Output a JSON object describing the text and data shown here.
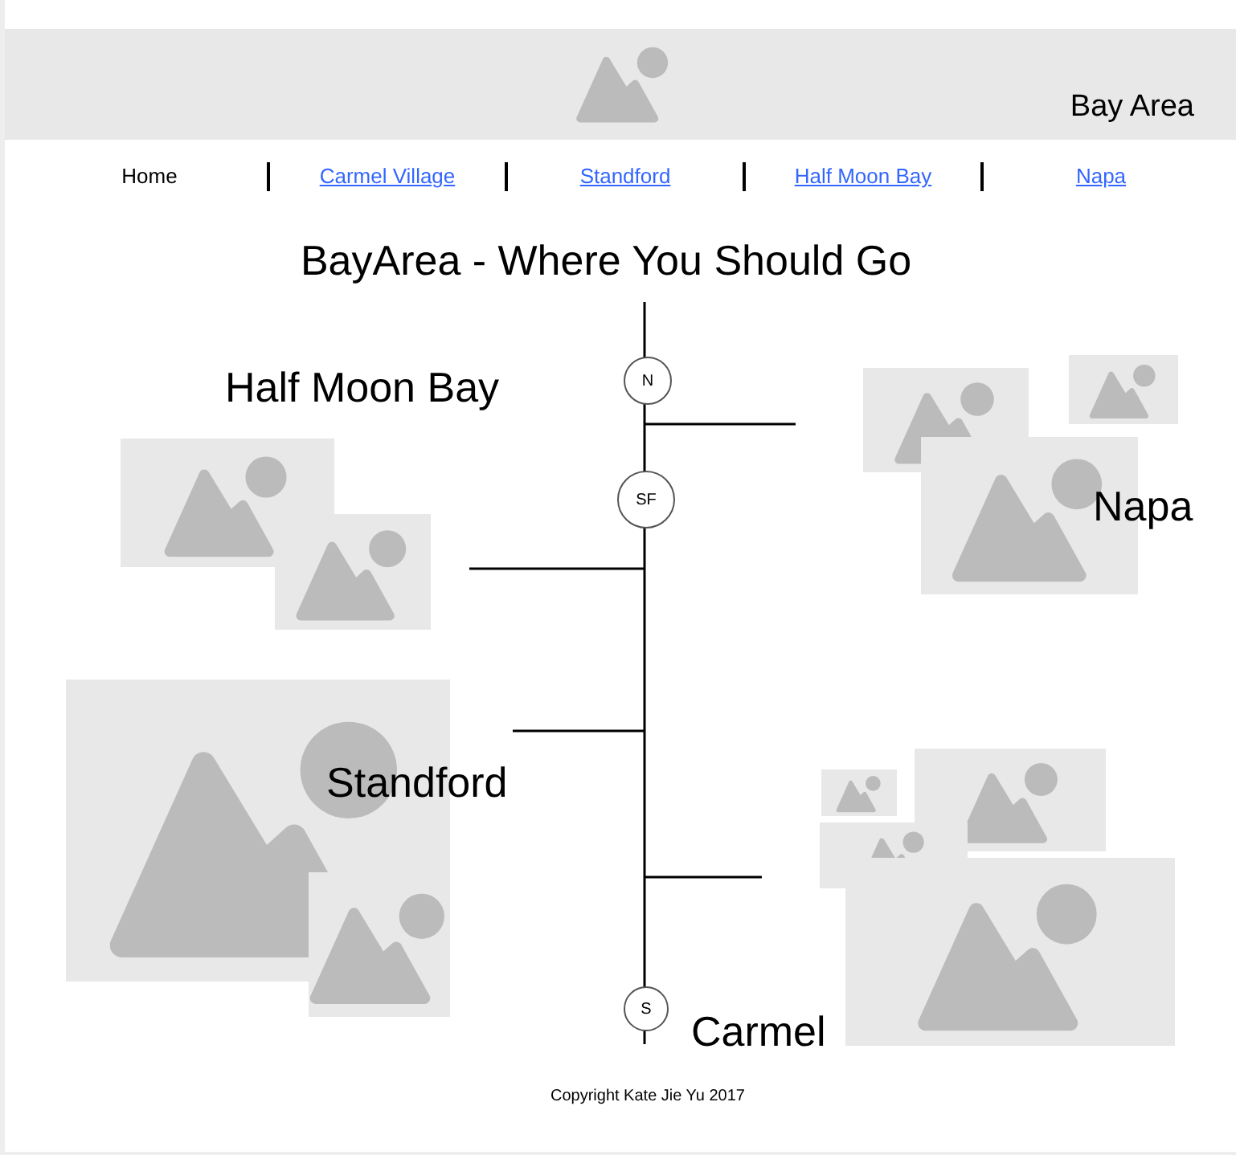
{
  "header": {
    "title": "Bay Area"
  },
  "nav": [
    {
      "label": "Home",
      "selected": true
    },
    {
      "label": "Carmel Village",
      "selected": false
    },
    {
      "label": "Standford",
      "selected": false
    },
    {
      "label": "Half Moon Bay",
      "selected": false
    },
    {
      "label": "Napa",
      "selected": false
    }
  ],
  "map": {
    "title": "BayArea - Where You Should Go",
    "stops": [
      {
        "label": "N"
      },
      {
        "label": "SF"
      },
      {
        "label": "S"
      }
    ],
    "places": [
      {
        "name": "Half Moon Bay"
      },
      {
        "name": "Napa"
      },
      {
        "name": "Standford"
      },
      {
        "name": "Carmel"
      }
    ]
  },
  "footer": {
    "text": "Copyright Kate Jie Yu 2017"
  }
}
